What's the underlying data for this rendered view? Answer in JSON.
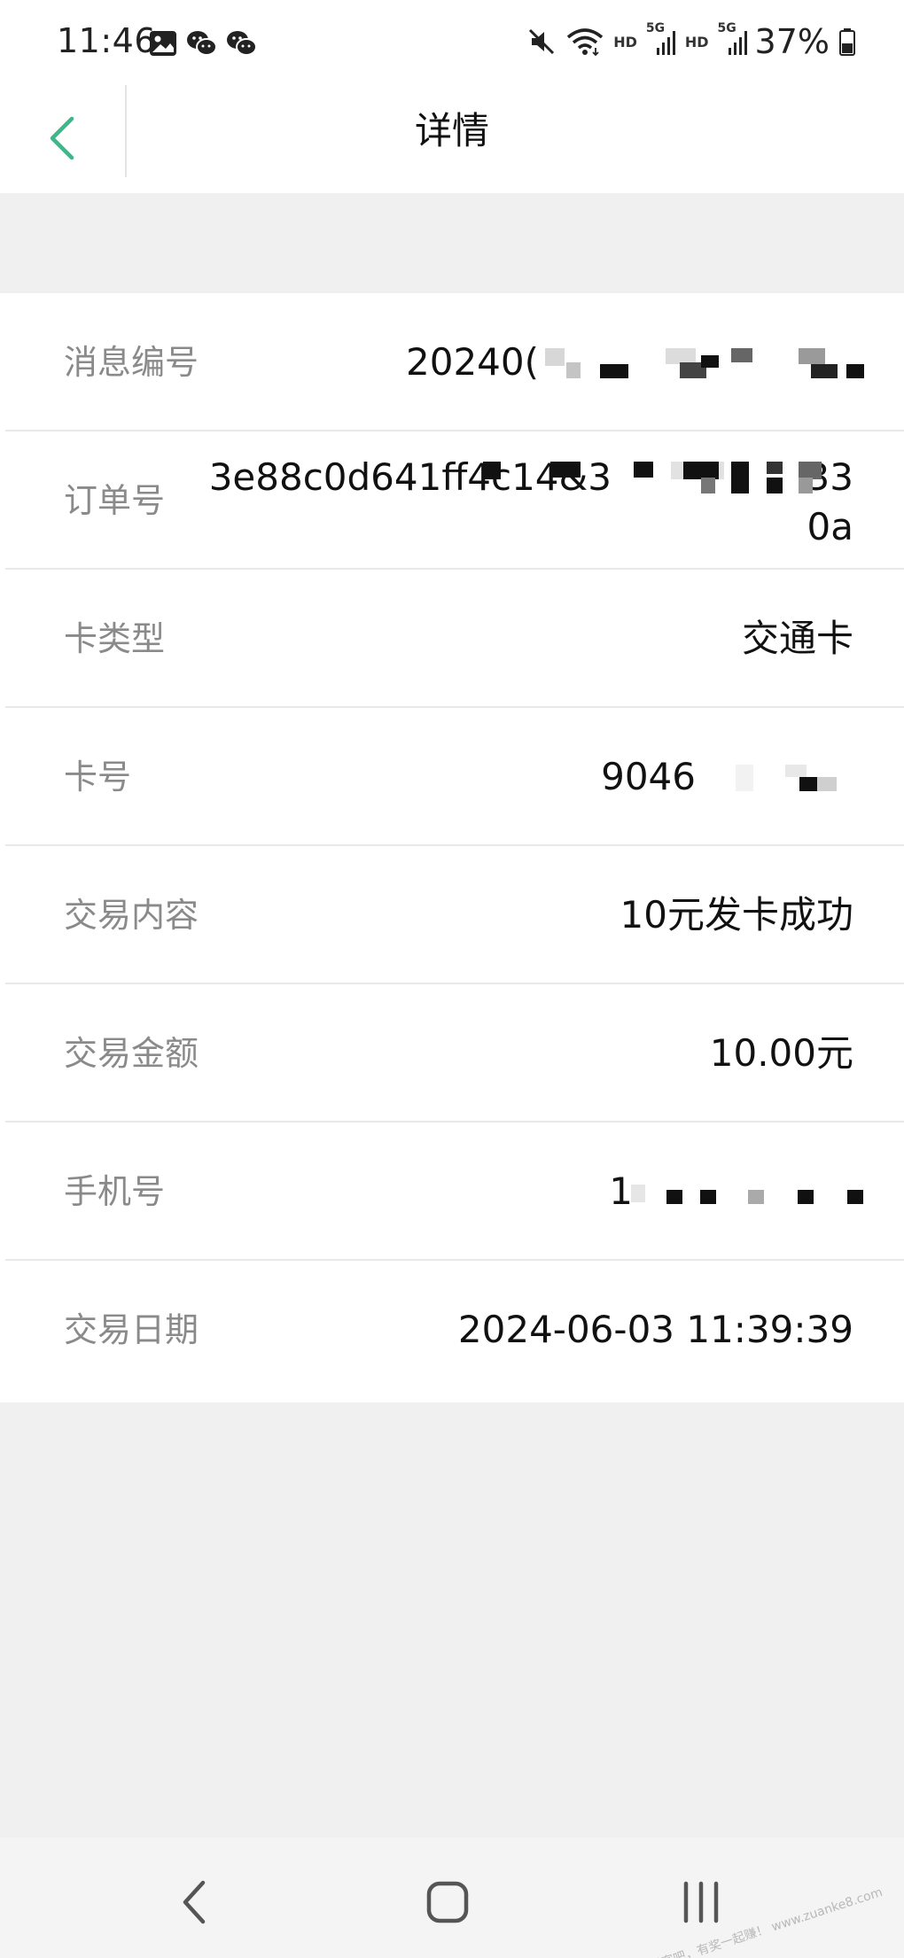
{
  "status_bar": {
    "time": "11:46",
    "hd_label_1": "HD",
    "net_label_1": "5G",
    "hd_label_2": "HD",
    "net_label_2": "5G",
    "battery": "37%",
    "icons": [
      "image-icon",
      "wechat-icon",
      "wechat-icon",
      "mute-icon",
      "wifi-icon",
      "signal-icon",
      "battery-icon"
    ]
  },
  "header": {
    "title": "详情",
    "back_icon": "chevron-left-icon",
    "accent_color": "#3fb58a"
  },
  "details": {
    "rows": [
      {
        "label": "消息编号",
        "value": "20240("
      },
      {
        "label": "订单号",
        "value_line1": "3e88c0d641ff4c14&3",
        "value_line2_suffix": "33",
        "value_line2": "0a"
      },
      {
        "label": "卡类型",
        "value": "交通卡"
      },
      {
        "label": "卡号",
        "value": "9046"
      },
      {
        "label": "交易内容",
        "value": "10元发卡成功"
      },
      {
        "label": "交易金额",
        "value": "10.00元"
      },
      {
        "label": "手机号",
        "value": "1"
      },
      {
        "label": "交易日期",
        "value": "2024-06-03 11:39:39"
      }
    ]
  },
  "nav": {
    "back_icon": "nav-back-icon",
    "home_icon": "nav-home-icon",
    "recents_icon": "nav-recents-icon"
  },
  "watermark": "赚客吧，有奖一起赚！ www.zuanke8.com"
}
